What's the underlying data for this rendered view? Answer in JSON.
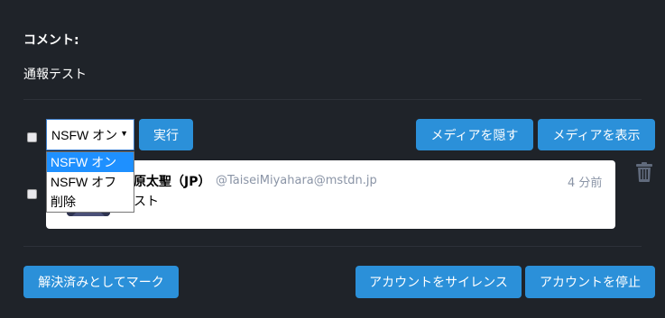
{
  "report": {
    "comment_heading": "コメント:",
    "comment_text": "通報テスト"
  },
  "toolbar": {
    "select_value": "NSFW オン",
    "run_button": "実行",
    "hide_media_button": "メディアを隠す",
    "show_media_button": "メディアを表示"
  },
  "dropdown": {
    "options": [
      {
        "label": "NSFW オン",
        "selected": true
      },
      {
        "label": "NSFW オフ",
        "selected": false
      },
      {
        "label": "削除",
        "selected": false
      }
    ]
  },
  "status": {
    "display_name": "宮原太聖（JP）",
    "acct": "@TaiseiMiyahara@mstdn.jp",
    "timestamp": "4 分前",
    "text": "テスト"
  },
  "footer": {
    "mark_resolved_button": "解決済みとしてマーク",
    "silence_button": "アカウントをサイレンス",
    "suspend_button": "アカウントを停止"
  },
  "colors": {
    "background": "#1f2329",
    "button": "#2b90d9",
    "selected_option": "#1e90ff"
  },
  "icons": [
    "trash-icon",
    "dropdown-arrow-icon"
  ]
}
